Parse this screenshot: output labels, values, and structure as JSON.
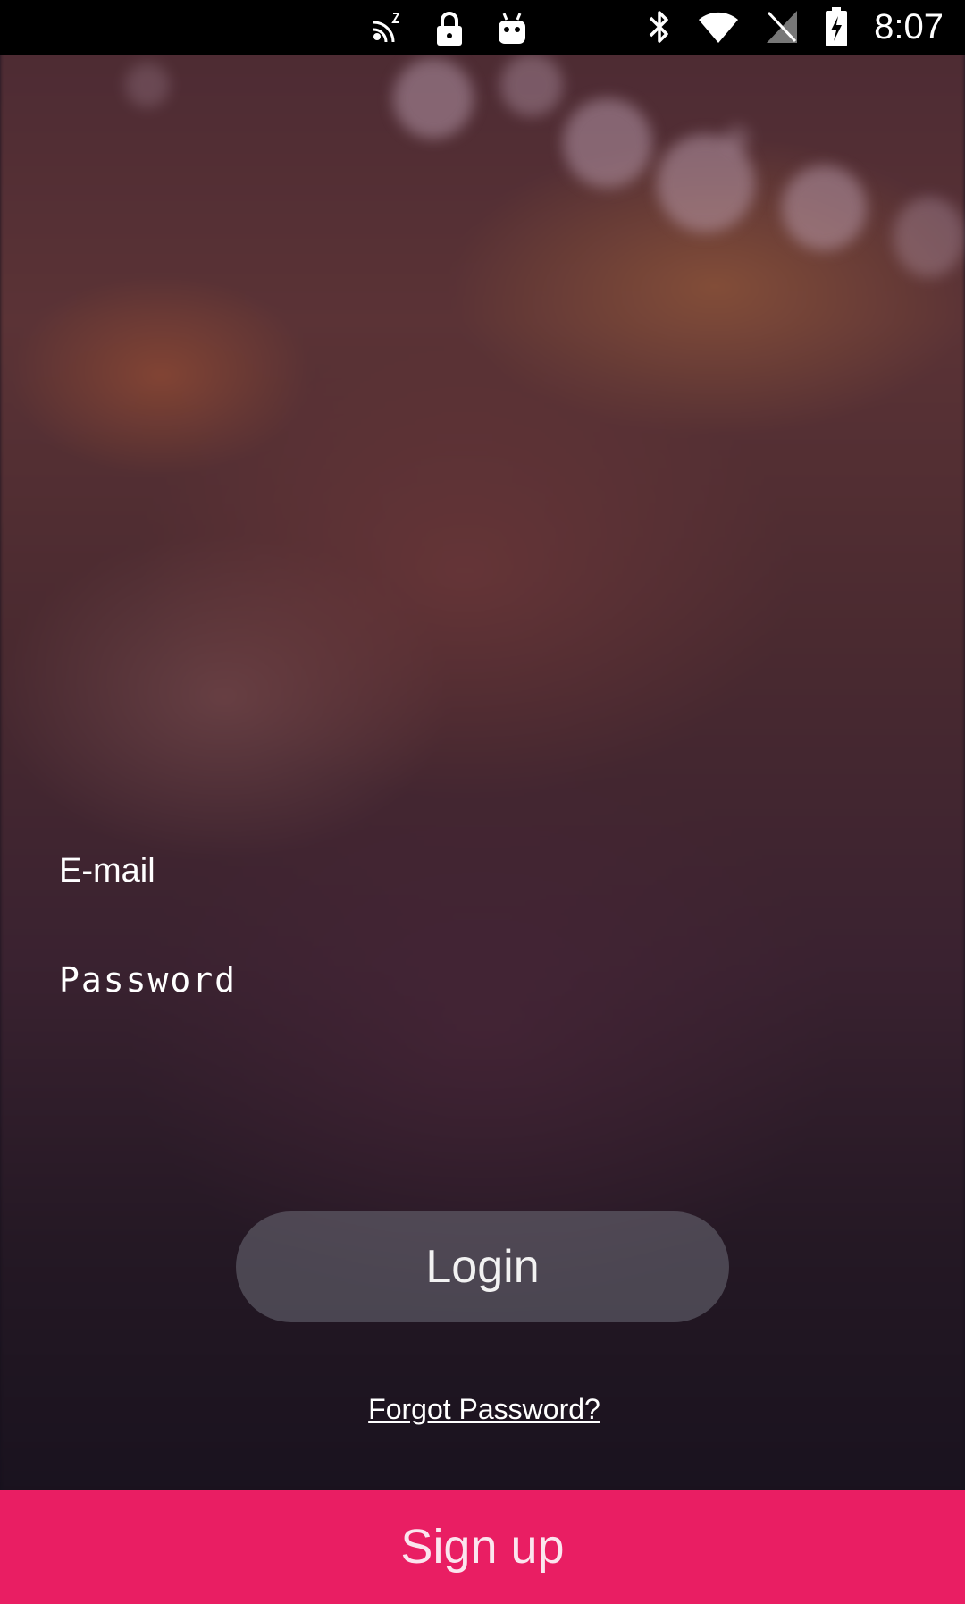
{
  "status_bar": {
    "time": "8:07",
    "left_icons": [
      "fake-signal-icon",
      "lock-icon",
      "android-icon"
    ],
    "right_icons": [
      "bluetooth-icon",
      "wifi-icon",
      "no-sim-icon",
      "battery-charging-icon"
    ]
  },
  "form": {
    "email_placeholder": "E-mail",
    "password_placeholder": "Password"
  },
  "actions": {
    "login_label": "Login",
    "forgot_label": "Forgot Password?",
    "signup_label": "Sign up"
  },
  "colors": {
    "signup_background": "#e91e63",
    "login_background": "rgba(110,110,120,0.55)"
  }
}
